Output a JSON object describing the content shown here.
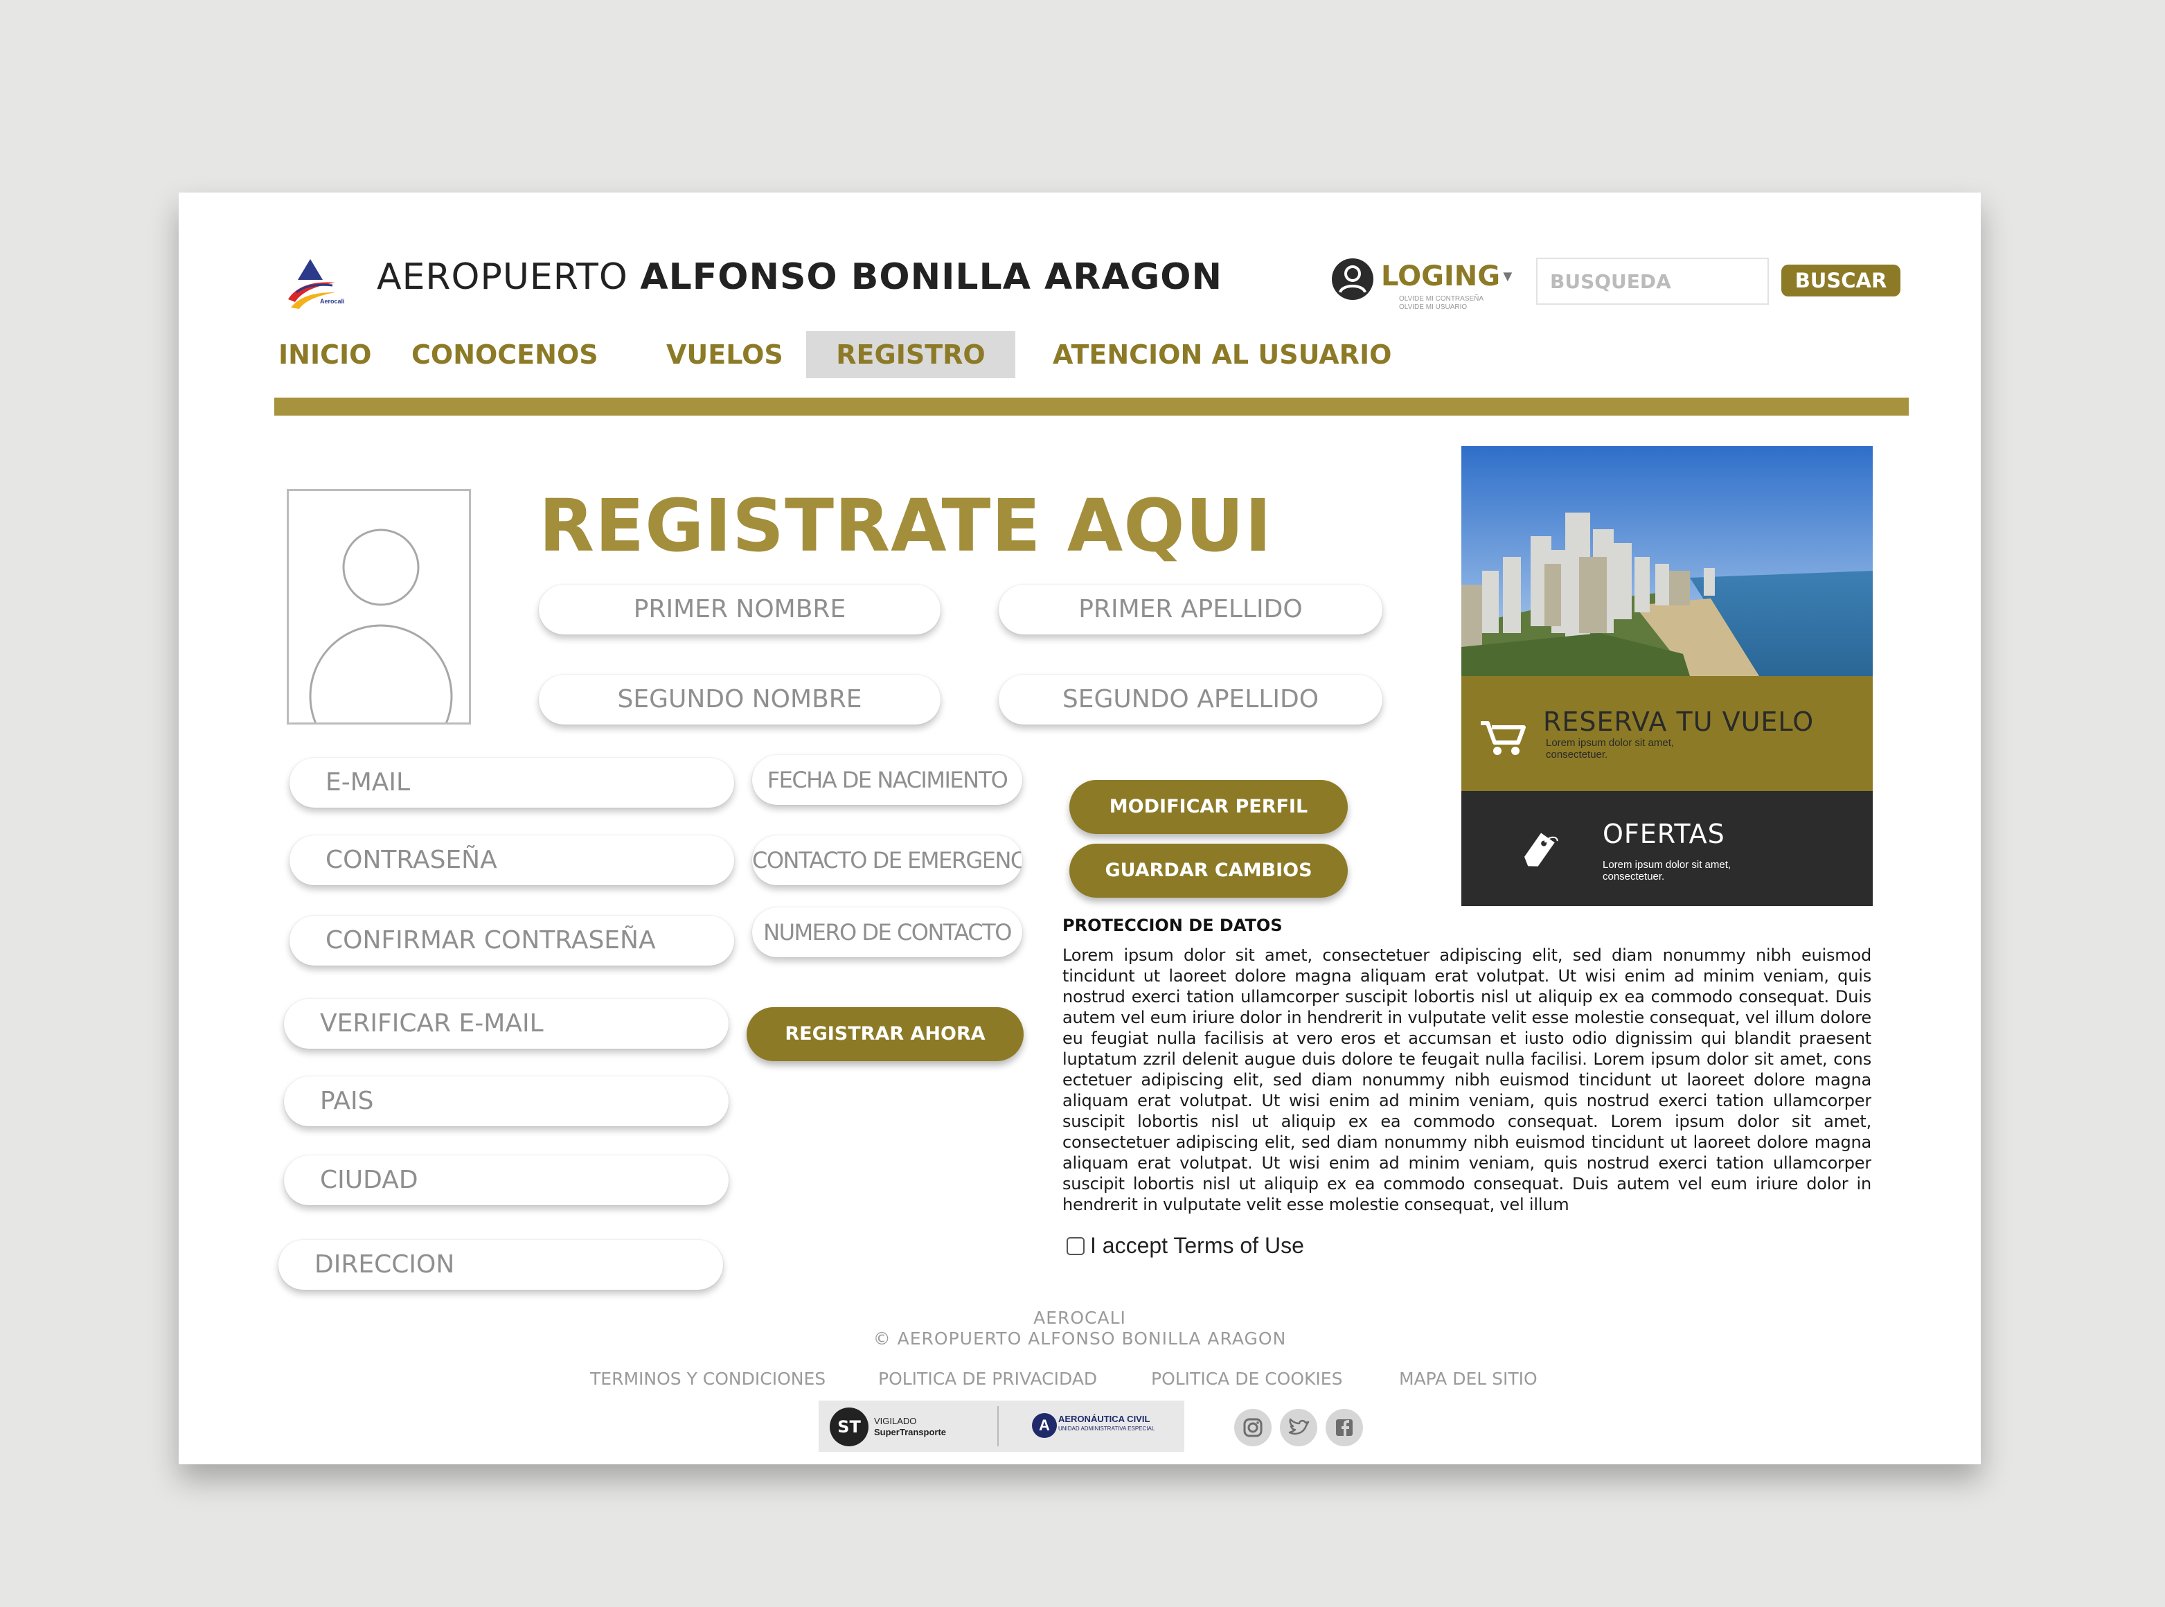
{
  "header": {
    "logo_text": "Aerocali",
    "title_light": "AEROPUERTO",
    "title_bold": "ALFONSO BONILLA ARAGON",
    "login_label": "LOGING",
    "login_sub_1": "OLVIDE MI CONTRASEÑA",
    "login_sub_2": "OLVIDE MI USUARIO",
    "search_placeholder": "BUSQUEDA",
    "search_button": "BUSCAR"
  },
  "nav": {
    "items": [
      "INICIO",
      "CONOCENOS",
      "VUELOS",
      "REGISTRO",
      "ATENCION AL USUARIO"
    ],
    "active": "REGISTRO"
  },
  "form": {
    "title": "REGISTRATE AQUI",
    "primer_nombre": "PRIMER NOMBRE",
    "primer_apellido": "PRIMER APELLIDO",
    "segundo_nombre": "SEGUNDO NOMBRE",
    "segundo_apellido": "SEGUNDO APELLIDO",
    "email": "E-MAIL",
    "contrasena": "CONTRASEÑA",
    "confirmar_contrasena": "CONFIRMAR CONTRASEÑA",
    "verificar_email": "VERIFICAR E-MAIL",
    "pais": "PAIS",
    "ciudad": "CIUDAD",
    "direccion": "DIRECCION",
    "fecha_nacimiento": "FECHA DE NACIMIENTO",
    "contacto_emergencia": "CONTACTO DE EMERGENCIA",
    "numero_contacto": "NUMERO DE CONTACTO",
    "registrar_button": "REGISTRAR AHORA",
    "modificar_button": "MODIFICAR PERFIL",
    "guardar_button": "GUARDAR CAMBIOS"
  },
  "data_protection": {
    "title": "PROTECCION DE DATOS",
    "text": "Lorem ipsum dolor sit amet, consectetuer adipiscing elit, sed diam nonummy nibh euismod tincidunt ut laoreet dolore magna aliquam erat volutpat. Ut wisi enim ad minim veniam, quis nostrud exerci tation ullamcorper suscipit lobortis nisl ut aliquip ex ea commodo consequat. Duis autem vel eum iriure dolor in hendrerit in vulputate velit esse molestie consequat, vel illum dolore eu feugiat nulla facilisis at vero eros et accumsan et iusto odio dignissim qui blandit praesent luptatum zzril delenit augue duis dolore te feugait nulla facilisi. Lorem ipsum dolor sit amet, cons ectetuer adipiscing elit, sed diam nonummy nibh euismod tincidunt ut laoreet dolore magna aliquam erat volutpat. Ut wisi enim ad minim veniam, quis nostrud exerci tation ullamcorper suscipit lobortis nisl ut aliquip ex ea commodo consequat. Lorem ipsum dolor sit amet, consectetuer adipiscing elit, sed diam nonummy nibh euismod tincidunt ut laoreet dolore magna aliquam erat volutpat. Ut wisi enim ad minim veniam, quis nostrud exerci tation ullamcorper suscipit lobortis nisl ut aliquip ex ea commodo consequat. Duis autem vel eum iriure dolor in hendrerit in vulputate velit esse molestie consequat, vel illum",
    "terms_label": "I accept Terms of Use"
  },
  "ads": {
    "reserve_title": "RESERVA TU VUELO",
    "reserve_text_1": "Lorem ipsum dolor sit amet,",
    "reserve_text_2": "consectetuer.",
    "ofertas_title": "OFERTAS",
    "ofertas_text_1": "Lorem ipsum dolor sit amet,",
    "ofertas_text_2": "consectetuer."
  },
  "footer": {
    "brand": "AEROCALI",
    "copyright": "© AEROPUERTO ALFONSO BONILLA ARAGON",
    "links": [
      "TERMINOS Y CONDICIONES",
      "POLITICA DE PRIVACIDAD",
      "POLITICA DE COOKIES",
      "MAPA DEL SITIO"
    ],
    "badge_st_1": "VIGILADO",
    "badge_st_2": "SuperTransporte",
    "badge_aero_1": "AERONÁUTICA CIVIL",
    "badge_aero_2": "UNIDAD ADMINISTRATIVA ESPECIAL"
  },
  "colors": {
    "accent": "#8c7a26",
    "accent_light": "#a7933d",
    "dark_panel": "#2c2c2c",
    "nav_active_bg": "#dadada"
  },
  "icons": [
    "aerocali-logo-icon",
    "user-icon",
    "caret-down-icon",
    "avatar-placeholder-icon",
    "cart-icon",
    "tag-icon",
    "instagram-icon",
    "twitter-icon",
    "facebook-icon"
  ]
}
